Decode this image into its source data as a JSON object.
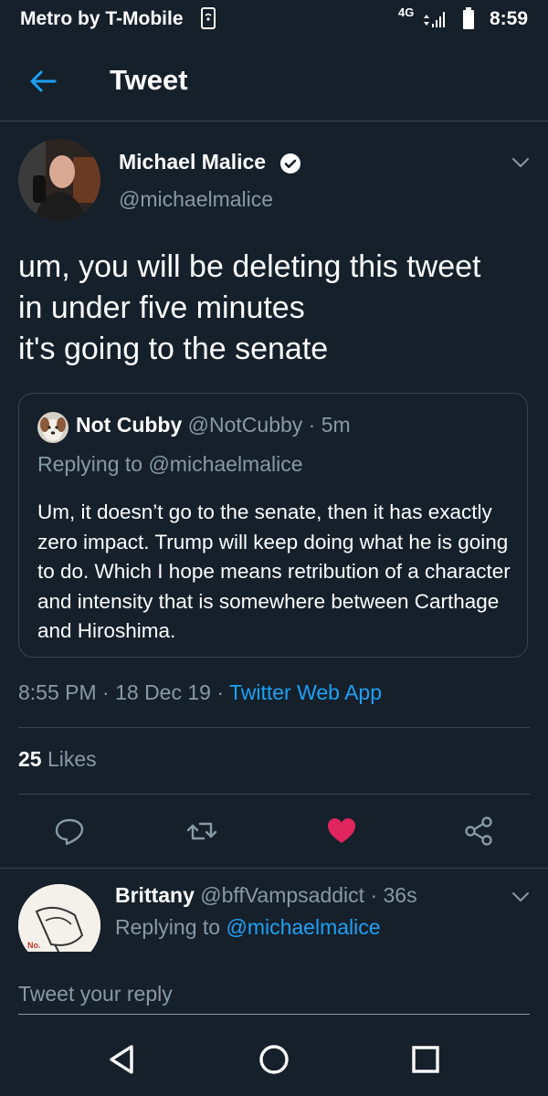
{
  "status_bar": {
    "carrier": "Metro by T-Mobile",
    "network": "4G",
    "time": "8:59"
  },
  "app_bar": {
    "title": "Tweet"
  },
  "tweet": {
    "author_name": "Michael Malice",
    "author_handle": "@michaelmalice",
    "verified": true,
    "text": "um, you will be deleting this tweet\nin under five minutes\nit's going to the senate",
    "timestamp": "8:55 PM · 18 Dec 19 · ",
    "source": "Twitter Web App",
    "likes_count": "25",
    "likes_label": " Likes",
    "liked": true
  },
  "quoted_tweet": {
    "author_name": "Not Cubby",
    "meta": " @NotCubby · 5m",
    "replying_to": "Replying to @michaelmalice",
    "text": "Um, it doesn’t go to the senate, then it has exactly zero impact. Trump will keep doing what he is going to do. Which I hope means retribution of a character and intensity that is somewhere between Carthage and Hiroshima."
  },
  "reply": {
    "author_name": "Brittany",
    "meta": " @bffVampsaddict · 36s",
    "replying_prefix": "Replying to ",
    "replying_handle": "@michaelmalice",
    "avatar_text": "No."
  },
  "compose": {
    "placeholder": "Tweet your reply"
  },
  "colors": {
    "background": "#15202b",
    "accent": "#1da1f2",
    "secondary_text": "#8899a6",
    "divider": "#38444d",
    "like": "#e0245e"
  }
}
